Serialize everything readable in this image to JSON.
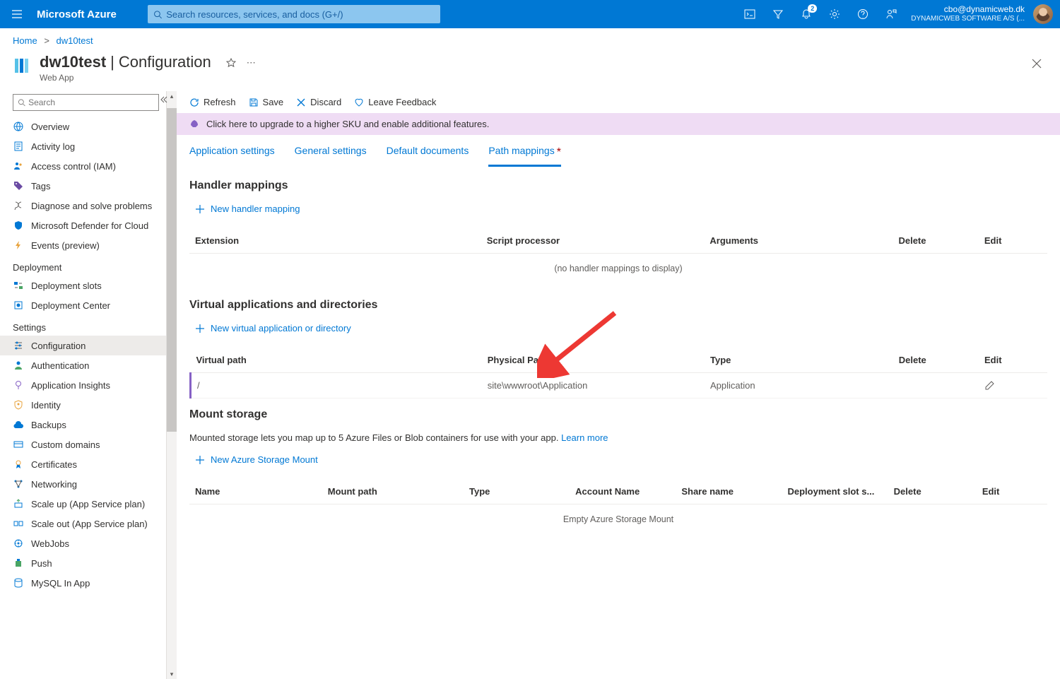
{
  "topbar": {
    "brand": "Microsoft Azure",
    "search_placeholder": "Search resources, services, and docs (G+/)",
    "notif_count": "2",
    "account_email": "cbo@dynamicweb.dk",
    "account_org": "DYNAMICWEB SOFTWARE A/S (..."
  },
  "breadcrumb": {
    "home": "Home",
    "current": "dw10test"
  },
  "page": {
    "title_main": "dw10test",
    "title_sep": " | ",
    "title_section": "Configuration",
    "subtitle": "Web App"
  },
  "toolbar": {
    "refresh": "Refresh",
    "save": "Save",
    "discard": "Discard",
    "feedback": "Leave Feedback"
  },
  "banner": {
    "text": "Click here to upgrade to a higher SKU and enable additional features."
  },
  "tabs": {
    "app_settings": "Application settings",
    "general": "General settings",
    "default_docs": "Default documents",
    "path_mappings": "Path mappings"
  },
  "sidebar": {
    "search_placeholder": "Search",
    "items_top": [
      {
        "label": "Overview"
      },
      {
        "label": "Activity log"
      },
      {
        "label": "Access control (IAM)"
      },
      {
        "label": "Tags"
      },
      {
        "label": "Diagnose and solve problems"
      },
      {
        "label": "Microsoft Defender for Cloud"
      },
      {
        "label": "Events (preview)"
      }
    ],
    "group_deploy": "Deployment",
    "items_deploy": [
      {
        "label": "Deployment slots"
      },
      {
        "label": "Deployment Center"
      }
    ],
    "group_settings": "Settings",
    "items_settings": [
      {
        "label": "Configuration",
        "active": true
      },
      {
        "label": "Authentication"
      },
      {
        "label": "Application Insights"
      },
      {
        "label": "Identity"
      },
      {
        "label": "Backups"
      },
      {
        "label": "Custom domains"
      },
      {
        "label": "Certificates"
      },
      {
        "label": "Networking"
      },
      {
        "label": "Scale up (App Service plan)"
      },
      {
        "label": "Scale out (App Service plan)"
      },
      {
        "label": "WebJobs"
      },
      {
        "label": "Push"
      },
      {
        "label": "MySQL In App"
      }
    ]
  },
  "handler": {
    "title": "Handler mappings",
    "add": "New handler mapping",
    "cols": {
      "ext": "Extension",
      "sp": "Script processor",
      "args": "Arguments",
      "del": "Delete",
      "edit": "Edit"
    },
    "empty": "(no handler mappings to display)"
  },
  "vapp": {
    "title": "Virtual applications and directories",
    "add": "New virtual application or directory",
    "cols": {
      "vp": "Virtual path",
      "pp": "Physical Path",
      "type": "Type",
      "del": "Delete",
      "edit": "Edit"
    },
    "rows": [
      {
        "vp": "/",
        "pp": "site\\wwwroot\\Application",
        "type": "Application"
      }
    ]
  },
  "mount": {
    "title": "Mount storage",
    "desc_a": "Mounted storage lets you map up to 5 Azure Files or Blob containers for use with your app. ",
    "desc_link": "Learn more",
    "add": "New Azure Storage Mount",
    "cols": {
      "name": "Name",
      "mp": "Mount path",
      "type": "Type",
      "an": "Account Name",
      "sn": "Share name",
      "dss": "Deployment slot s...",
      "del": "Delete",
      "edit": "Edit"
    },
    "empty": "Empty Azure Storage Mount"
  }
}
